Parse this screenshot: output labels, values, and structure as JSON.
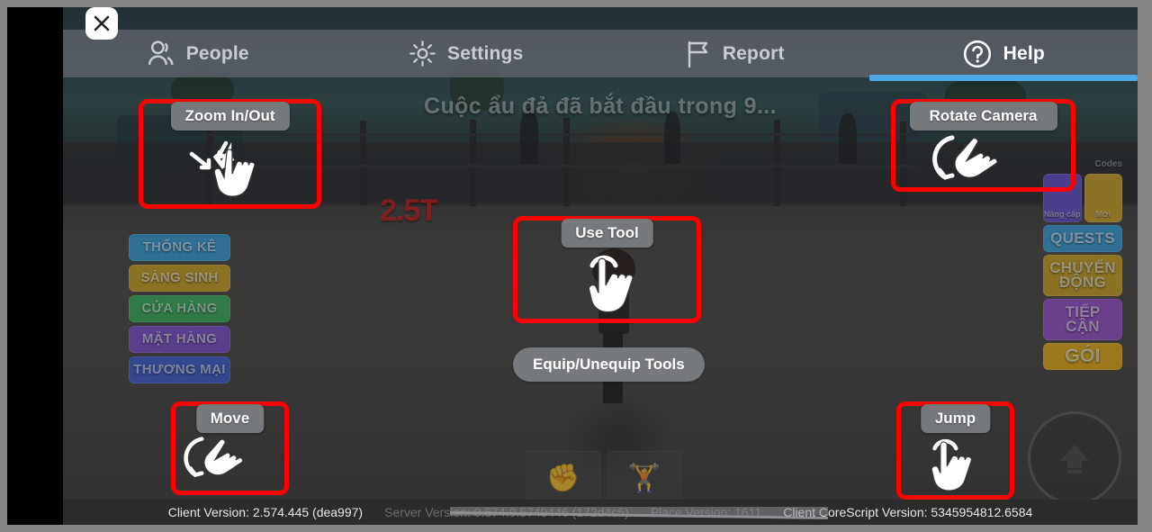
{
  "window": {
    "close_label": "×"
  },
  "tabs": [
    {
      "label": "People",
      "icon": "people-icon",
      "active": false
    },
    {
      "label": "Settings",
      "icon": "gear-icon",
      "active": false
    },
    {
      "label": "Report",
      "icon": "flag-icon",
      "active": false
    },
    {
      "label": "Help",
      "icon": "question-icon",
      "active": true
    }
  ],
  "annotations": [
    {
      "id": "zoom",
      "label": "Zoom In/Out",
      "icon": "pinch-hand-icon"
    },
    {
      "id": "rotate",
      "label": "Rotate Camera",
      "icon": "swipe-hand-icon"
    },
    {
      "id": "use",
      "label": "Use Tool",
      "icon": "tap-hand-icon"
    },
    {
      "id": "move",
      "label": "Move",
      "icon": "swipe-hand-icon"
    },
    {
      "id": "jump",
      "label": "Jump",
      "icon": "tap-hand-icon"
    }
  ],
  "equip_button": {
    "label": "Equip/Unequip Tools"
  },
  "game": {
    "banner": "Cuộc ẩu đả đã bắt đầu trong 9...",
    "damage": "2.5T",
    "sidebar_left": [
      {
        "label": "THỐNG KÊ",
        "color": "#2f6f92"
      },
      {
        "label": "SẢNG SINH",
        "color": "#8a7324"
      },
      {
        "label": "CỬA HÀNG",
        "color": "#2f7a46"
      },
      {
        "label": "MẶT HÀNG",
        "color": "#5a3f8c"
      },
      {
        "label": "THƯƠNG MẠI",
        "color": "#34478f"
      }
    ],
    "sidebar_right_mini": [
      {
        "label": "Nâng cấp",
        "color": "#4a3f8c"
      },
      {
        "label": "Mời",
        "color": "#8a7324"
      }
    ],
    "codes_tag": "Codes",
    "sidebar_right": [
      {
        "label": "QUESTS",
        "color": "#2f6f92"
      },
      {
        "label": "CHUYỂN ĐỘNG",
        "color": "#8a7324"
      },
      {
        "label": "TIẾP CẬN",
        "color": "#6a3f8c"
      },
      {
        "label": "GÓI",
        "color": "#9a7a1c"
      }
    ],
    "inventory": [
      {
        "icon": "fist-icon",
        "glyph": "✊"
      },
      {
        "icon": "dumbbell-icon",
        "glyph": "🏋"
      }
    ],
    "jump_button_icon": "up-arrow-icon"
  },
  "status": {
    "client_version": "Client Version: 2.574.445 (dea997)",
    "server_version": "Server Version: 0.574.0.5749446 (172d4c5)",
    "place_version": "Place Version: 1611",
    "corescript_version": "Client CoreScript Version: 5345954812.6584"
  },
  "colors": {
    "accent": "#4fa8e8",
    "annotation": "#ff0000",
    "tabbar": "#585c64",
    "pill": "#76797c"
  }
}
